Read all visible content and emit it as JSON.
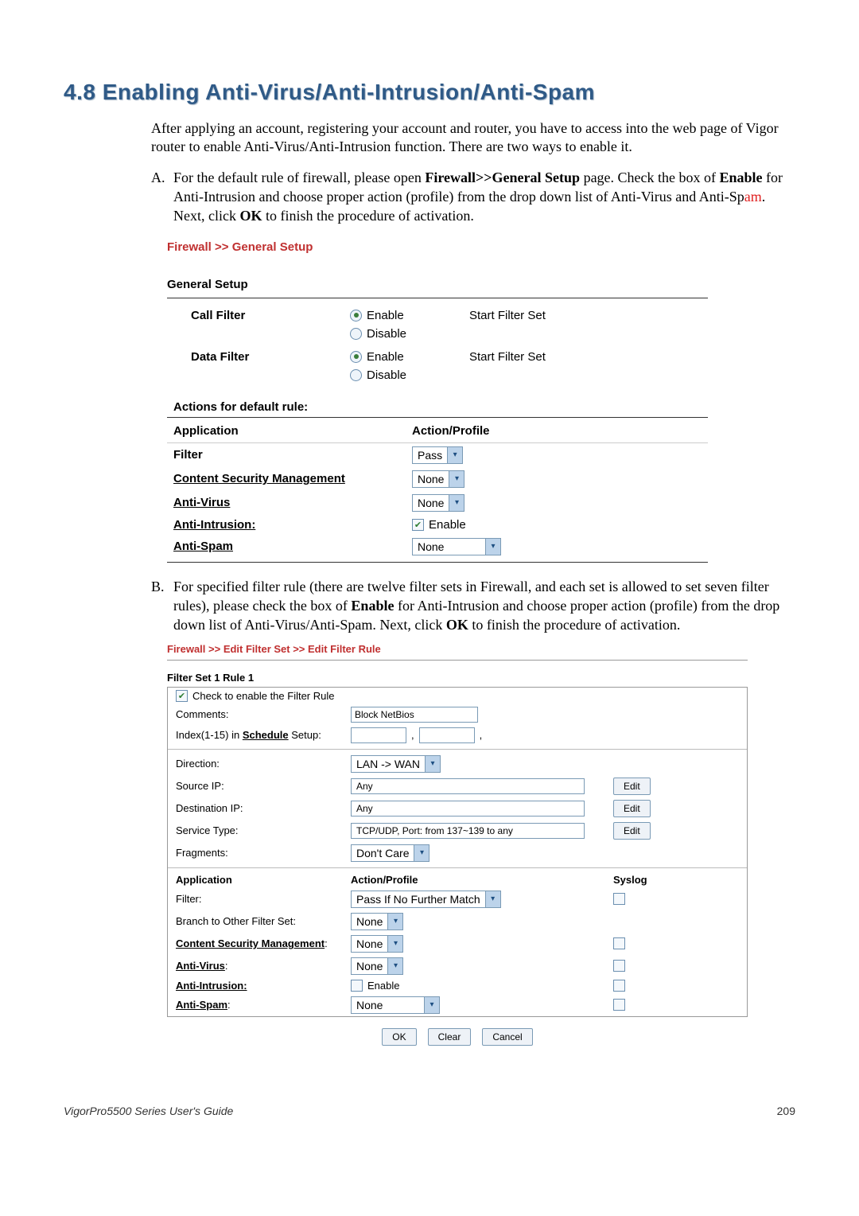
{
  "heading": "4.8 Enabling Anti-Virus/Anti-Intrusion/Anti-Spam",
  "intro": "After applying an account, registering your account and router, you have to access into the web page of Vigor router to enable Anti-Virus/Anti-Intrusion function. There are two ways to enable it.",
  "itemA_marker": "A.",
  "itemA_p1": "For the default rule of firewall, please open ",
  "itemA_b1": "Firewall>>General Setup",
  "itemA_p2": " page. Check the box of ",
  "itemA_b2": "Enable",
  "itemA_p3": " for Anti-Intrusion and choose proper action (profile) from the drop down list of Anti-Virus and Anti-Sp",
  "itemA_red": "am",
  "itemA_p4": ". Next, click ",
  "itemA_b3": "OK",
  "itemA_p5": " to finish the procedure of activation.",
  "itemB_marker": "B.",
  "itemB_p1": "For specified filter rule (there are twelve filter sets in Firewall, and each set is allowed to set seven filter rules), please check the box of ",
  "itemB_b1": "Enable",
  "itemB_p2": " for Anti-Intrusion and choose proper action (profile) from the drop down list of Anti-Virus/Anti-Spam. Next, click ",
  "itemB_b2": "OK",
  "itemB_p3": " to finish the procedure of activation.",
  "inset1": {
    "breadcrumb": "Firewall >> General Setup",
    "title": "General Setup",
    "call_filter_label": "Call Filter",
    "data_filter_label": "Data Filter",
    "enable": "Enable",
    "disable": "Disable",
    "start_filter_set": "Start Filter Set",
    "actions_heading": "Actions for default rule:",
    "col_app": "Application",
    "col_action": "Action/Profile",
    "row_filter": "Filter",
    "row_csm": "Content Security Management",
    "row_av": "Anti-Virus",
    "row_ai": "Anti-Intrusion:",
    "row_as": "Anti-Spam",
    "sel_pass": "Pass",
    "sel_none": "None"
  },
  "inset2": {
    "breadcrumb": "Firewall >> Edit Filter Set >> Edit Filter Rule",
    "title": "Filter Set 1 Rule 1",
    "check_label": "Check to enable the Filter Rule",
    "comments_label": "Comments:",
    "comments_value": "Block NetBios",
    "schedule_label": "Index(1-15) in ",
    "schedule_link": "Schedule",
    "schedule_suffix": " Setup:",
    "direction_label": "Direction:",
    "direction_value": "LAN -> WAN",
    "source_label": "Source IP:",
    "source_value": "Any",
    "dest_label": "Destination IP:",
    "dest_value": "Any",
    "service_label": "Service Type:",
    "service_value": "TCP/UDP, Port: from 137~139 to any",
    "fragments_label": "Fragments:",
    "fragments_value": "Don't Care",
    "edit_btn": "Edit",
    "hdr_app": "Application",
    "hdr_action": "Action/Profile",
    "hdr_syslog": "Syslog",
    "r_filter": "Filter:",
    "r_filter_val": "Pass If No Further Match",
    "r_branch": "Branch to Other Filter Set:",
    "r_branch_val": "None",
    "r_csm": "Content Security Management",
    "r_csm_val": "None",
    "r_av": "Anti-Virus",
    "r_av_val": "None",
    "r_ai": "Anti-Intrusion:",
    "r_ai_val": "Enable",
    "r_as": "Anti-Spam",
    "r_as_val": "None",
    "btn_ok": "OK",
    "btn_clear": "Clear",
    "btn_cancel": "Cancel"
  },
  "footer_left": "VigorPro5500 Series User's Guide",
  "footer_right": "209"
}
